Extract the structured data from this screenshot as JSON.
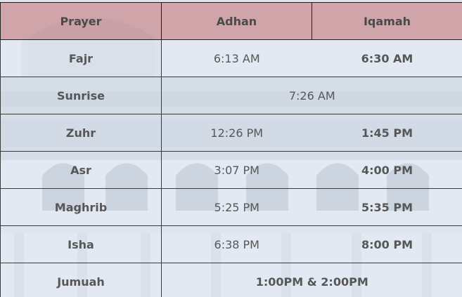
{
  "headers": {
    "prayer": "Prayer",
    "adhan": "Adhan",
    "iqamah": "Iqamah"
  },
  "rows": [
    {
      "name": "Fajr",
      "adhan": "6:13 AM",
      "iqamah": "6:30 AM"
    },
    {
      "name": "Sunrise",
      "time": "7:26 AM"
    },
    {
      "name": "Zuhr",
      "adhan": "12:26 PM",
      "iqamah": "1:45 PM"
    },
    {
      "name": "Asr",
      "adhan": "3:07 PM",
      "iqamah": "4:00 PM"
    },
    {
      "name": "Maghrib",
      "adhan": "5:25 PM",
      "iqamah": "5:35 PM"
    },
    {
      "name": "Isha",
      "adhan": "6:38 PM",
      "iqamah": "8:00 PM"
    },
    {
      "name": "Jumuah",
      "time": "1:00PM & 2:00PM"
    }
  ],
  "colors": {
    "header_bg": "#cc9ba0",
    "row_bg": "#e4eaf4",
    "text": "#575757"
  }
}
